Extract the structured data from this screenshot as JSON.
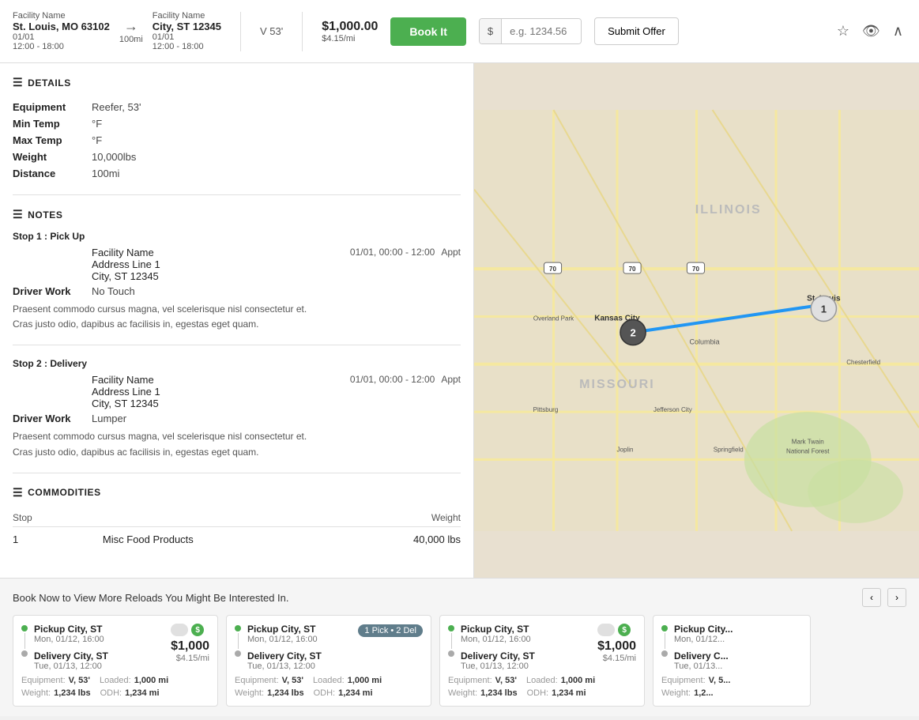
{
  "header": {
    "origin": {
      "label": "Facility Name",
      "city": "St. Louis, MO 63102",
      "date": "01/01",
      "time": "12:00 - 18:00"
    },
    "dest": {
      "label": "Facility Name",
      "city": "City, ST 12345",
      "date": "01/01",
      "time": "12:00 - 18:00"
    },
    "distance": "100mi",
    "equipment": "V 53'",
    "price": "$1,000.00",
    "rate": "$4.15/mi",
    "book_it_label": "Book It",
    "dollar_symbol": "$",
    "offer_placeholder": "e.g. 1234.56",
    "submit_offer_label": "Submit Offer"
  },
  "details": {
    "section_label": "DETAILS",
    "rows": [
      {
        "label": "Equipment",
        "value": "Reefer, 53'"
      },
      {
        "label": "Min Temp",
        "value": "°F"
      },
      {
        "label": "Max Temp",
        "value": "°F"
      },
      {
        "label": "Weight",
        "value": "10,000lbs"
      },
      {
        "label": "Distance",
        "value": "100mi"
      }
    ]
  },
  "notes": {
    "section_label": "NOTES",
    "stops": [
      {
        "header": "Stop 1 : Pick Up",
        "facility": "Facility Name",
        "address": "Address Line 1",
        "city_st": "City, ST 12345",
        "date_range": "01/01, 00:00 - 12:00",
        "appt": "Appt",
        "driver_work_label": "Driver Work",
        "driver_work_val": "No Touch",
        "note": "Praesent commodo cursus magna, vel scelerisque nisl consectetur et.\nCras justo odio, dapibus ac facilisis in, egestas eget quam."
      },
      {
        "header": "Stop 2 : Delivery",
        "facility": "Facility Name",
        "address": "Address Line 1",
        "city_st": "City, ST 12345",
        "date_range": "01/01, 00:00 - 12:00",
        "appt": "Appt",
        "driver_work_label": "Driver Work",
        "driver_work_val": "Lumper",
        "note": "Praesent commodo cursus magna, vel scelerisque nisl consectetur et.\nCras justo odio, dapibus ac facilisis in, egestas eget quam."
      }
    ]
  },
  "commodities": {
    "section_label": "COMMODITIES",
    "columns": [
      "Stop",
      "Weight"
    ],
    "rows": [
      {
        "stop": "1",
        "description": "Misc Food Products",
        "weight": "40,000 lbs"
      }
    ]
  },
  "bottom": {
    "title": "Book Now to View More Reloads You Might Be Interested In.",
    "cards": [
      {
        "pickup_city": "Pickup City, ST",
        "pickup_date": "Mon, 01/12, 16:00",
        "delivery_city": "Delivery City, ST",
        "delivery_date": "Tue, 01/13, 12:00",
        "price": "$1,000",
        "rate": "$4.15/mi",
        "badge_type": "gray_dollar",
        "equipment": "V, 53'",
        "weight": "1,234 lbs",
        "odh": "1,234 mi",
        "loaded": "1,000 mi"
      },
      {
        "pickup_city": "Pickup City, ST",
        "pickup_date": "Mon, 01/12, 16:00",
        "delivery_city": "Delivery City, ST",
        "delivery_date": "Tue, 01/13, 12:00",
        "price": "",
        "rate": "",
        "badge_type": "1pick2del",
        "equipment": "V, 53'",
        "weight": "1,234 lbs",
        "odh": "1,234 mi",
        "loaded": "1,000 mi"
      },
      {
        "pickup_city": "Pickup City, ST",
        "pickup_date": "Mon, 01/12, 16:00",
        "delivery_city": "Delivery City, ST",
        "delivery_date": "Tue, 01/13, 12:00",
        "price": "$1,000",
        "rate": "$4.15/mi",
        "badge_type": "gray_dollar",
        "equipment": "V, 53'",
        "weight": "1,234 lbs",
        "odh": "1,234 mi",
        "loaded": "1,000 mi"
      },
      {
        "pickup_city": "Pickup City...",
        "pickup_date": "Mon, 01/12, ...",
        "delivery_city": "Delivery C...",
        "delivery_date": "Tue, 01/13, ...",
        "price": "",
        "rate": "",
        "badge_type": "none",
        "equipment": "V, 5...",
        "weight": "1,2...",
        "odh": "",
        "loaded": ""
      }
    ]
  }
}
